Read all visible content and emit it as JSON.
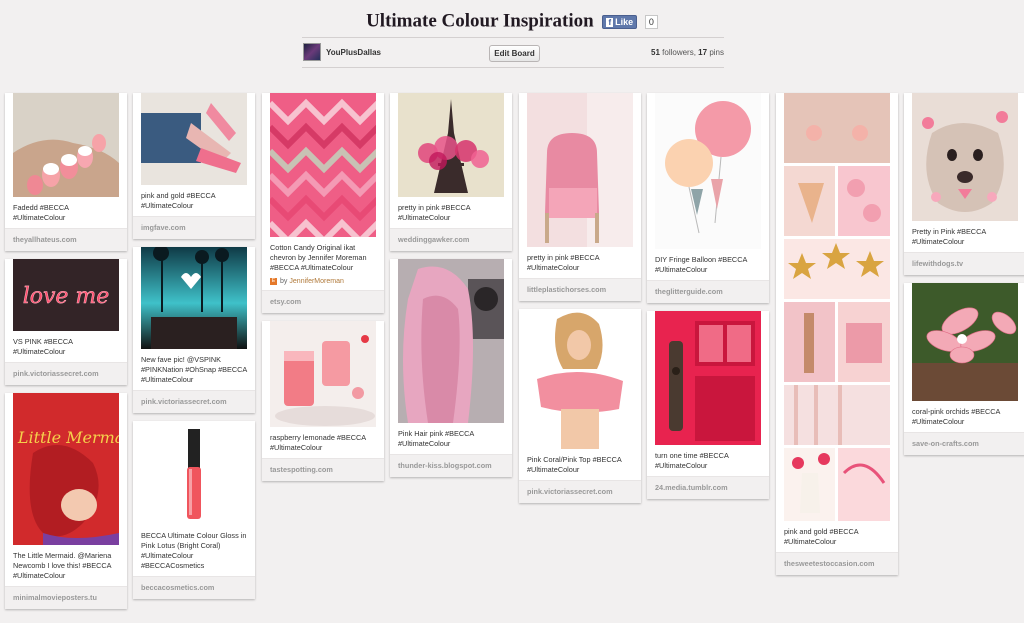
{
  "board": {
    "title": "Ultimate Colour Inspiration",
    "fb_like": "Like",
    "fb_count": "0",
    "owner": "YouPlusDallas",
    "edit_button": "Edit Board",
    "followers": "51",
    "followers_label": "followers,",
    "pins": "17",
    "pins_label": "pins"
  },
  "pins": {
    "p1": {
      "desc": "Fadedd #BECCA #UltimateColour",
      "source": "theyallhateus.com"
    },
    "p2": {
      "desc": "VS PINK #BECCA #UltimateColour",
      "source": "pink.victoriassecret.com"
    },
    "p3": {
      "desc": "The Little Mermaid. @Mariena Newcomb I love this! #BECCA #UltimateColour",
      "source": "minimalmovieposters.tu"
    },
    "p4": {
      "desc": "pink and gold #BECCA #UltimateColour",
      "source": "imgfave.com"
    },
    "p5": {
      "desc": "New fave pic! @VSPINK #PINKNation #OhSnap #BECCA #UltimateColour",
      "source": "pink.victoriassecret.com"
    },
    "p6": {
      "desc": "BECCA Ultimate Colour Gloss in Pink Lotus (Bright Coral) #UltimateColour #BECCACosmetics",
      "source": "beccacosmetics.com"
    },
    "p7": {
      "desc": "Cotton Candy Original ikat chevron by Jennifer Moreman #BECCA #UltimateColour",
      "via": "by",
      "via_name": "JenniferMoreman",
      "source": "etsy.com"
    },
    "p8": {
      "desc": "raspberry lemonade #BECCA #UltimateColour",
      "source": "tastespotting.com"
    },
    "p9": {
      "desc": "pretty in pink #BECCA #UltimateColour",
      "source": "weddinggawker.com"
    },
    "p10": {
      "desc": "Pink Hair pink #BECCA #UltimateColour",
      "source": "thunder-kiss.blogspot.com"
    },
    "p11": {
      "desc": "pretty in pink #BECCA #UltimateColour",
      "source": "littleplastichorses.com"
    },
    "p12": {
      "desc": "Pink Coral/Pink Top #BECCA #UltimateColour",
      "source": "pink.victoriassecret.com"
    },
    "p13": {
      "desc": "DIY Fringe Balloon #BECCA #UltimateColour",
      "source": "theglitterguide.com"
    },
    "p14": {
      "desc": "turn one time #BECCA #UltimateColour",
      "source": "24.media.tumblr.com"
    },
    "p15": {
      "desc": "pink and gold #BECCA #UltimateColour",
      "source": "thesweetestoccasion.com"
    },
    "p16": {
      "desc": "Pretty in Pink #BECCA #UltimateColour",
      "source": "lifewithdogs.tv"
    },
    "p17": {
      "desc": "coral-pink orchids #BECCA #UltimateColour",
      "source": "save-on-crafts.com"
    }
  },
  "image_text": {
    "neon": "love me",
    "mermaid": "The Little Mermaid"
  }
}
